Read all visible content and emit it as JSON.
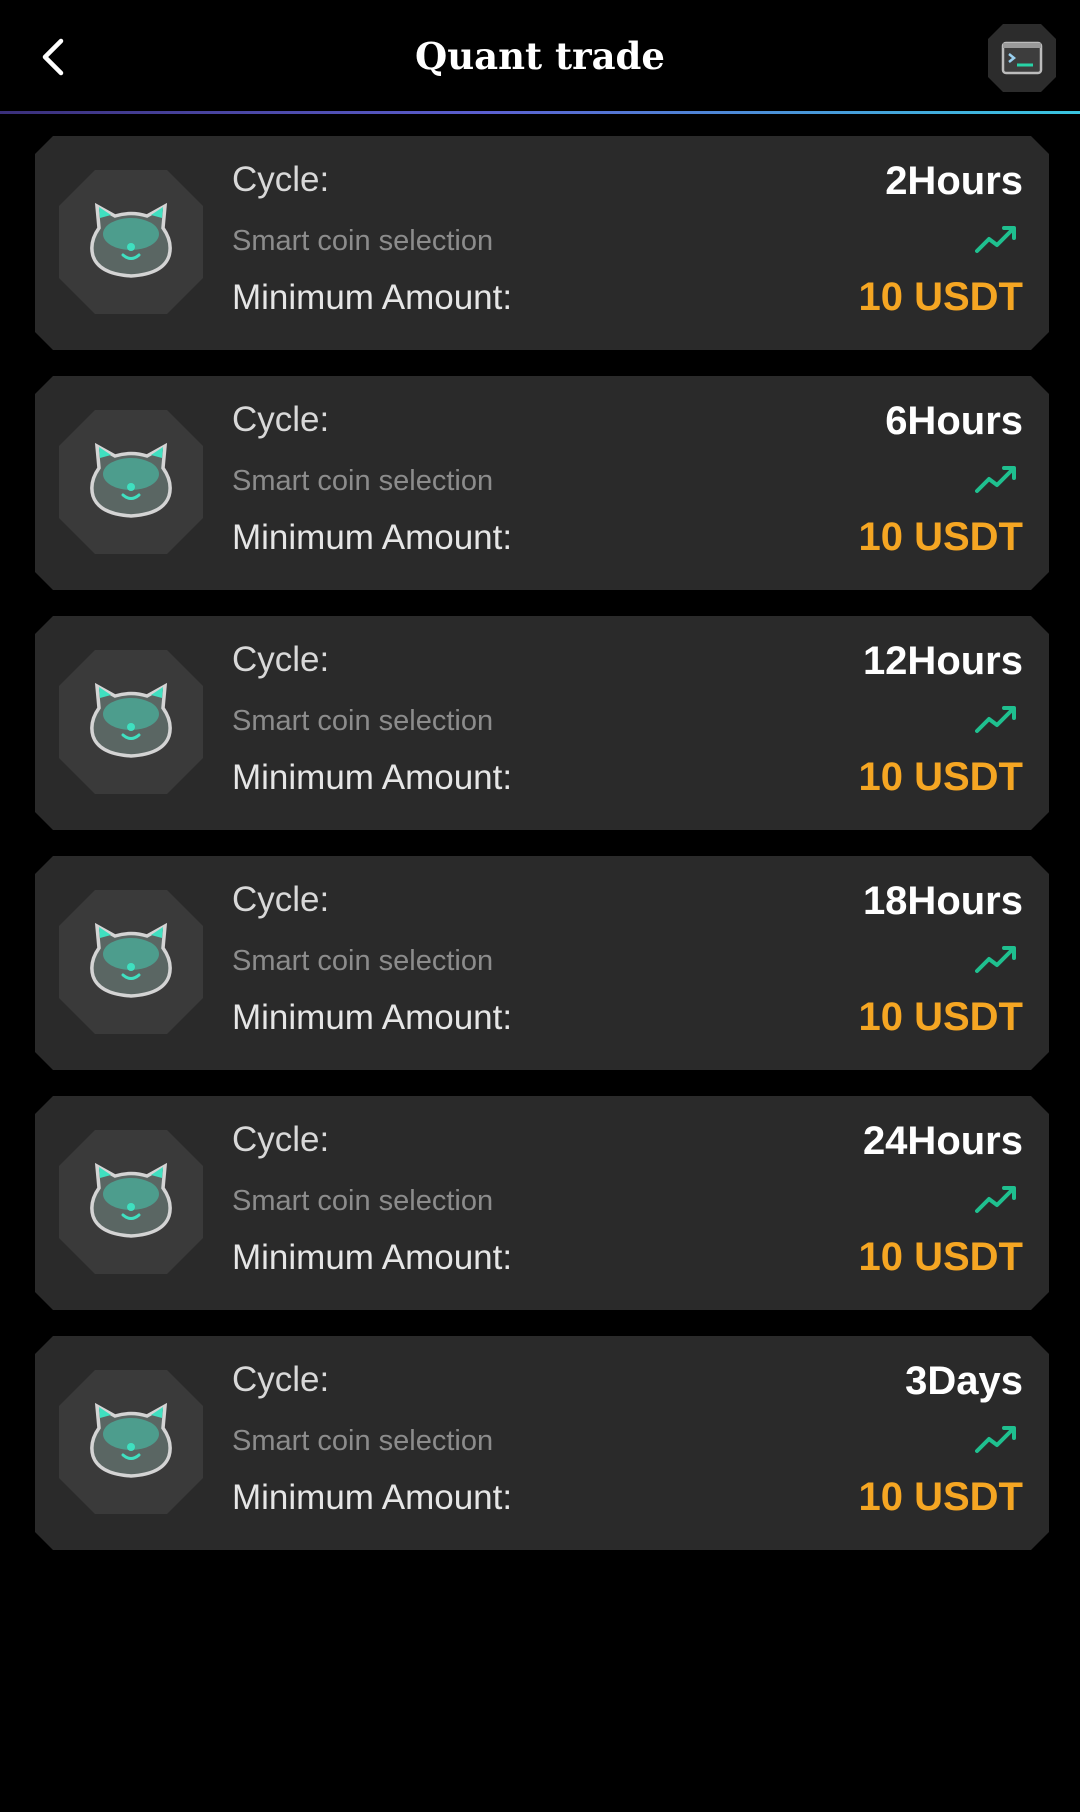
{
  "header": {
    "title": "Quant trade",
    "back_icon": "chevron-left-icon",
    "terminal_icon": "terminal-icon"
  },
  "colors": {
    "background": "#000000",
    "card": "#2a2a2a",
    "amount": "#f5a623",
    "trend": "#1fbf8f",
    "accent_line": "#5b5fd0"
  },
  "plans": [
    {
      "cycle_label": "Cycle:",
      "cycle_value": "2Hours",
      "subtitle": "Smart coin selection",
      "min_label": "Minimum Amount:",
      "min_value": "10 USDT",
      "icon": "bear-coin-icon",
      "trend_icon": "trending-up-icon"
    },
    {
      "cycle_label": "Cycle:",
      "cycle_value": "6Hours",
      "subtitle": "Smart coin selection",
      "min_label": "Minimum Amount:",
      "min_value": "10 USDT",
      "icon": "bear-coin-icon",
      "trend_icon": "trending-up-icon"
    },
    {
      "cycle_label": "Cycle:",
      "cycle_value": "12Hours",
      "subtitle": "Smart coin selection",
      "min_label": "Minimum Amount:",
      "min_value": "10 USDT",
      "icon": "bear-coin-icon",
      "trend_icon": "trending-up-icon"
    },
    {
      "cycle_label": "Cycle:",
      "cycle_value": "18Hours",
      "subtitle": "Smart coin selection",
      "min_label": "Minimum Amount:",
      "min_value": "10 USDT",
      "icon": "bear-coin-icon",
      "trend_icon": "trending-up-icon"
    },
    {
      "cycle_label": "Cycle:",
      "cycle_value": "24Hours",
      "subtitle": "Smart coin selection",
      "min_label": "Minimum Amount:",
      "min_value": "10 USDT",
      "icon": "bear-coin-icon",
      "trend_icon": "trending-up-icon"
    },
    {
      "cycle_label": "Cycle:",
      "cycle_value": "3Days",
      "subtitle": "Smart coin selection",
      "min_label": "Minimum Amount:",
      "min_value": "10 USDT",
      "icon": "bear-coin-icon",
      "trend_icon": "trending-up-icon"
    }
  ]
}
